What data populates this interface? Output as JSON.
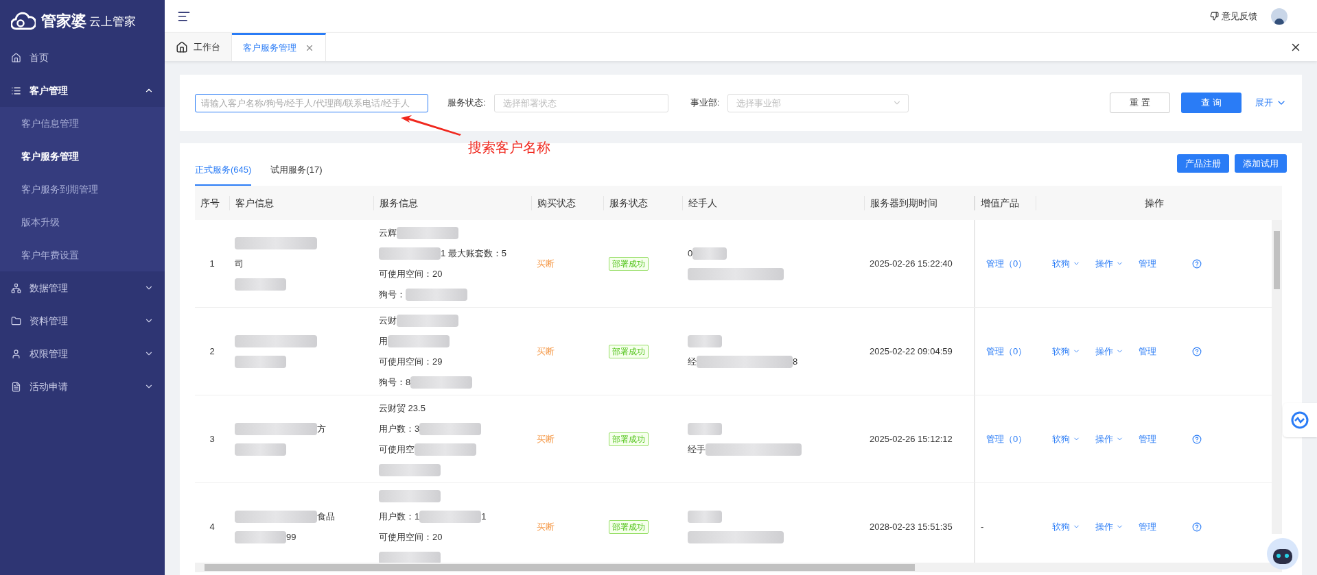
{
  "brand": {
    "name": "管家婆",
    "suffix": "云上管家"
  },
  "sidebar": {
    "items": [
      {
        "label": "首页",
        "expanded": false
      },
      {
        "label": "客户管理",
        "expanded": true,
        "children": [
          {
            "label": "客户信息管理",
            "selected": false
          },
          {
            "label": "客户服务管理",
            "selected": true
          },
          {
            "label": "客户服务到期管理",
            "selected": false
          },
          {
            "label": "版本升级",
            "selected": false
          },
          {
            "label": "客户年费设置",
            "selected": false
          }
        ]
      },
      {
        "label": "数据管理",
        "expanded": false
      },
      {
        "label": "资料管理",
        "expanded": false
      },
      {
        "label": "权限管理",
        "expanded": false
      },
      {
        "label": "活动申请",
        "expanded": false
      }
    ]
  },
  "header": {
    "feedback": "意见反馈"
  },
  "page_tabs": [
    {
      "label": "工作台",
      "kind": "home",
      "selected": false
    },
    {
      "label": "客户服务管理",
      "kind": "closable",
      "selected": true
    }
  ],
  "filters": {
    "search": {
      "placeholder": "请输入客户名称/狗号/经手人/代理商/联系电话/经手人"
    },
    "service_status": {
      "label": "服务状态:",
      "placeholder": "选择部署状态"
    },
    "department": {
      "label": "事业部:",
      "placeholder": "选择事业部"
    },
    "reset": "重 置",
    "query": "查 询",
    "expand": "展开"
  },
  "annotation": {
    "text": "搜索客户名称"
  },
  "service_tabs": [
    {
      "label": "正式服务(645)",
      "selected": true
    },
    {
      "label": "试用服务(17)",
      "selected": false
    }
  ],
  "actions": [
    "产品注册",
    "添加试用"
  ],
  "table": {
    "columns": [
      "序号",
      "客户信息",
      "服务信息",
      "购买状态",
      "服务状态",
      "经手人",
      "服务器到期时间",
      "增值产品",
      "操作"
    ],
    "rows": [
      {
        "index": "1",
        "customer": [
          {
            "redacted": true
          },
          {
            "before": "司",
            "redacted": false
          },
          {
            "redacted": true
          }
        ],
        "service": [
          {
            "before": "云辉",
            "redacted": true
          },
          {
            "redacted": true,
            "after": "1 最大账套数：5"
          },
          {
            "before": "可使用空间：20",
            "redacted": false
          },
          {
            "before": "狗号：",
            "redacted": true
          }
        ],
        "purchase": "买断",
        "status": "部署成功",
        "handler": [
          {
            "before": "0",
            "redacted": true
          },
          {
            "redacted": true
          }
        ],
        "expiry": "2025-02-26 15:22:40",
        "value_added": "管理（0）",
        "value_added_link": true,
        "ops": {
          "dongle": "软狗",
          "operate": "操作",
          "manage": "管理"
        }
      },
      {
        "index": "2",
        "customer": [
          {
            "redacted": true
          },
          {
            "redacted": true
          }
        ],
        "service": [
          {
            "before": "云财",
            "redacted": true
          },
          {
            "before": "用",
            "redacted": true
          },
          {
            "before": "可使用空间：29",
            "redacted": false
          },
          {
            "before": "狗号：8",
            "redacted": true
          }
        ],
        "purchase": "买断",
        "status": "部署成功",
        "handler": [
          {
            "redacted": true
          },
          {
            "before": "经",
            "redacted": true,
            "after": "8"
          }
        ],
        "expiry": "2025-02-22 09:04:59",
        "value_added": "管理（0）",
        "value_added_link": true,
        "ops": {
          "dongle": "软狗",
          "operate": "操作",
          "manage": "管理"
        }
      },
      {
        "index": "3",
        "customer": [
          {
            "redacted": true,
            "after": "方"
          },
          {
            "redacted": true
          }
        ],
        "service": [
          {
            "before": "云财贸 23.5",
            "redacted": false
          },
          {
            "before": "用户数：3",
            "redacted": true
          },
          {
            "before": "可使用空",
            "redacted": true
          },
          {
            "redacted": true
          }
        ],
        "purchase": "买断",
        "status": "部署成功",
        "handler": [
          {
            "redacted": true
          },
          {
            "before": "经手",
            "redacted": true
          }
        ],
        "expiry": "2025-02-26 15:12:12",
        "value_added": "管理（0）",
        "value_added_link": true,
        "ops": {
          "dongle": "软狗",
          "operate": "操作",
          "manage": "管理"
        }
      },
      {
        "index": "4",
        "customer": [
          {
            "redacted": true,
            "after": "食品"
          },
          {
            "redacted": true,
            "after": "99"
          }
        ],
        "service": [
          {
            "redacted": true
          },
          {
            "before": "用户数：1",
            "redacted": true,
            "after": "1"
          },
          {
            "before": "可使用空间：20",
            "redacted": false
          },
          {
            "redacted": true
          }
        ],
        "purchase": "买断",
        "status": "部署成功",
        "handler": [
          {
            "redacted": true
          },
          {
            "redacted": true
          }
        ],
        "expiry": "2028-02-23 15:51:35",
        "value_added": "-",
        "value_added_link": false,
        "ops": {
          "dongle": "软狗",
          "operate": "操作",
          "manage": "管理"
        }
      }
    ]
  }
}
